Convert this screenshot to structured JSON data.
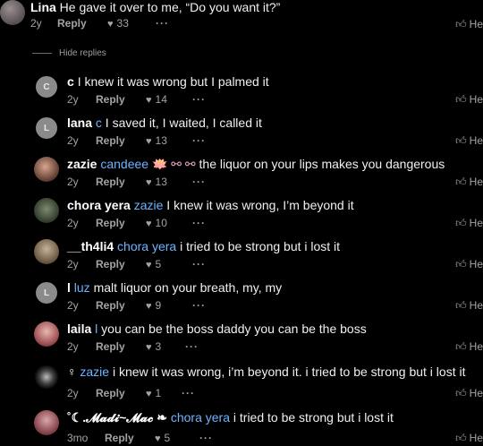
{
  "top_comment": {
    "username": "Lina",
    "text": "He gave it over to me, “Do you want it?”",
    "age": "2y",
    "reply_label": "Reply",
    "likes": "33",
    "helpful": "He"
  },
  "hide_replies_label": "Hide replies",
  "replies": [
    {
      "username": "c",
      "avatar_letter": "C",
      "mention": "",
      "text": "I knew it was wrong but I palmed it",
      "age": "2y",
      "reply_label": "Reply",
      "likes": "14",
      "helpful": "He"
    },
    {
      "username": "lana",
      "avatar_letter": "L",
      "mention": "c",
      "text": "I saved it, I waited, I called it",
      "age": "2y",
      "reply_label": "Reply",
      "likes": "13",
      "helpful": "He"
    },
    {
      "username": "zazie",
      "avatar_letter": "",
      "mention": "candeee",
      "emoji": "🪷 ⚯ ⚯",
      "text": "the liquor on your lips makes you dangerous",
      "age": "2y",
      "reply_label": "Reply",
      "likes": "13",
      "helpful": "He"
    },
    {
      "username": "chora yera",
      "avatar_letter": "",
      "mention": "zazie",
      "text": "I knew it was wrong, I’m beyond it",
      "age": "2y",
      "reply_label": "Reply",
      "likes": "10",
      "helpful": "He"
    },
    {
      "username": "__th4li4",
      "avatar_letter": "",
      "mention": "chora yera",
      "text": "i tried to be strong but i lost it",
      "age": "2y",
      "reply_label": "Reply",
      "likes": "5",
      "helpful": "He"
    },
    {
      "username": "l",
      "avatar_letter": "L",
      "mention": "luz",
      "text": "malt liquor on your breath, my, my",
      "age": "2y",
      "reply_label": "Reply",
      "likes": "9",
      "helpful": "He"
    },
    {
      "username": "laila",
      "avatar_letter": "",
      "mention": "l",
      "text": "you can be the boss daddy you can be the boss",
      "age": "2y",
      "reply_label": "Reply",
      "likes": "3",
      "helpful": "He"
    },
    {
      "username": "♀",
      "avatar_letter": "",
      "mention": "zazie",
      "text": "i knew it was wrong, i’m beyond it. i tried to be strong but i lost it",
      "age": "2y",
      "reply_label": "Reply",
      "likes": "1",
      "helpful": "He"
    },
    {
      "username": "˚☾.𝓜𝓪𝓭𝓲~𝓜𝓪𝓬 ❧",
      "avatar_letter": "",
      "mention": "chora yera",
      "text": "i tried to be strong but i lost it",
      "age": "3mo",
      "reply_label": "Reply",
      "likes": "5",
      "helpful": "He"
    }
  ],
  "icons": {
    "like": "heart-icon",
    "more": "ellipsis-icon",
    "helpful": "thumbs-up-icon"
  },
  "colors": {
    "background": "#000000",
    "mention": "#6fb3ff",
    "muted": "#a3a3a3"
  }
}
